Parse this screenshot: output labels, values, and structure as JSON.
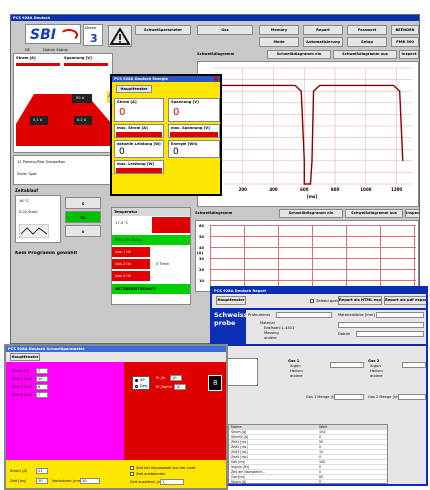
{
  "main_window": {
    "title": "PCS 928A Deutsch",
    "logo": "SBI",
    "ebene_label": "Ebene",
    "ebene_value": "3",
    "toolbar": {
      "schweissparameter": "Schweißparameter",
      "gas": "Gas",
      "memory": "Memory",
      "report": "Report",
      "passwort": "Passwort",
      "beenden": "BEENDEN",
      "mode": "Mode",
      "automatisierung": "Automatisierung",
      "setup": "Setup",
      "model": "PMB 300"
    },
    "info_row": [
      "DE",
      "Datum Status"
    ],
    "strom_label": "Strom [A]",
    "spannung_label": "Spannung [V]",
    "zone_labels": [
      "Zon",
      "50 A",
      "0.1 A",
      "0.2 A"
    ],
    "mode_text": "12 Plasma-Pilot Schweißen",
    "mode_sub": "Zone: Spot",
    "schweissdiagramm_label": "Schweißdiagramm",
    "tabs": {
      "ein": "Schweißdiagramm ein",
      "aus": "Schweißdiagramm aus",
      "inspect": "Inspect"
    },
    "chart_xlabel": "[ms]",
    "chart_xticks": [
      "200",
      "400",
      "600",
      "800",
      "1000",
      "1200"
    ],
    "zeitablauf_label": "Zeitablauf",
    "zeit_values": [
      "16 °C",
      "0.02 Stroh"
    ],
    "zeit_buttons": [
      "S",
      "30",
      "0"
    ],
    "kein_programm": "Kein Programm gewählt",
    "temperatur_label": "Temperatur",
    "temperatur_value": "17.4 °C",
    "status_items": [
      "PMB ON Status",
      "Gas 1 Ok",
      "Gas 2 Ok",
      "Gas 3 Ok"
    ],
    "timer_value": "0 Timin",
    "netz_label": "NETZBEREITSCHAFT",
    "chart2_ylabel": "[A]",
    "chart2_yticks": [
      "60",
      "50",
      "40",
      "30",
      "20",
      "10"
    ],
    "chart2_label": "Schweißdiagramm",
    "chart2_tabs": {
      "ein": "Schweißdiagramm ein",
      "aus": "Schweißdiagramm aus",
      "inspect": "Inspect"
    }
  },
  "chart_data": {
    "type": "line",
    "xlim": [
      0,
      1300
    ],
    "ylim": [
      0,
      10
    ],
    "xticks": [
      200,
      400,
      600,
      800,
      1000,
      1200
    ],
    "xlabel": "[ms]",
    "series": [
      {
        "x": [
          0,
          0,
          20,
          60,
          540,
          580,
          600,
          600,
          640,
          650,
          660,
          700,
          1180,
          1220,
          1240
        ],
        "y": [
          0,
          2,
          8,
          8.5,
          8.5,
          8,
          2,
          0,
          0,
          2,
          8,
          8.5,
          8.5,
          8,
          2
        ]
      }
    ]
  },
  "energie_window": {
    "title": "PCS 928A Deutsch Energie",
    "hauptfenster": "Hauptfenster",
    "strom_label": "Strom [A]",
    "strom_value": "0",
    "spannung_label": "Spannung [V]",
    "spannung_value": "0",
    "max_strom_label": "max. Strom [A]",
    "max_spannung_label": "max. Spannung [V]",
    "leistung_label": "aktuelle Leistung [W]",
    "leistung_value": "0",
    "energie_label": "Energie [Wh]",
    "energie_value": "0",
    "max_leistung_label": "max. Leistung [W]"
  },
  "report_window": {
    "title": "PCS 928A Deutsch Report",
    "hauptfenster": "Hauptfenster",
    "checkbox_label": "Zeitabl.quell",
    "report_tab1": "Report als HTML exportieren",
    "report_tab2": "Report als pdf exportieren",
    "schweiss_label": "Schweiss-probe",
    "pruefnummer_label": "Prüfnummer",
    "materialstaerke_label": "Materialstärke [mm]",
    "material_label": "Material",
    "material_options": [
      "Edelstahl 1.4301",
      "Messing",
      "andere"
    ],
    "datum_label": "Datum",
    "gas_blocks": [
      {
        "label": "Gas 1",
        "options": [
          "Argon",
          "Helium",
          "andere"
        ]
      },
      {
        "label": "Gas 2",
        "options": [
          "Argon",
          "Helium",
          "andere"
        ]
      }
    ],
    "gas_menge": [
      "Gas 1 Menge [l/min]",
      "Gas 2 Menge [l/min]"
    ],
    "table_headers": [
      "Name",
      "Wert"
    ],
    "table_rows": [
      [
        "Strom [A]",
        "154"
      ],
      [
        "Strom2 [A]",
        "0"
      ],
      [
        "Zeit1 [ms]",
        "50"
      ],
      [
        "Zeit2 [ms]",
        "0"
      ],
      [
        "Zeit3 [ms]",
        "10"
      ],
      [
        "Zeit4 [ms]",
        "0"
      ],
      [
        "Gas [ms]",
        "100"
      ],
      [
        "Impuls [Hz]",
        "0"
      ],
      [
        "Zeit am Nachgleich...",
        "0"
      ],
      [
        "Gas [ms]",
        "60"
      ],
      [
        "Strom [A]",
        "0"
      ]
    ]
  },
  "param_window": {
    "title": "PCS 928A Deutsch Schweißparameter",
    "hauptfenster": "Hauptfenster",
    "fields": [
      "Strom [A]",
      "Zeit 1 [ms]",
      "Zeit 2 [ms]",
      "Zeit 3 [ms]"
    ],
    "field_values": [
      "7",
      "10",
      "6",
      "7"
    ],
    "radio_options": [
      "AP",
      "Deb"
    ],
    "pn_label": "Pr_Nr",
    "pn_value": "10",
    "pa_label": "Pr_Name",
    "pa_value": "10",
    "counter_value": "8",
    "bottom_fields": [
      "Strom [A]",
      "Zeit [ms]"
    ],
    "bottom_values": [
      "21",
      "10"
    ],
    "extra_label": "Nachstrom [mm]",
    "extra_value": "10",
    "checkboxes": [
      "Zeit bei Impulswahl aus der Liste",
      "Zeit ausblenden"
    ],
    "zeitkonfig_label": "Zeit ausblend. [ms]",
    "zeitkonfig_value": "1"
  }
}
